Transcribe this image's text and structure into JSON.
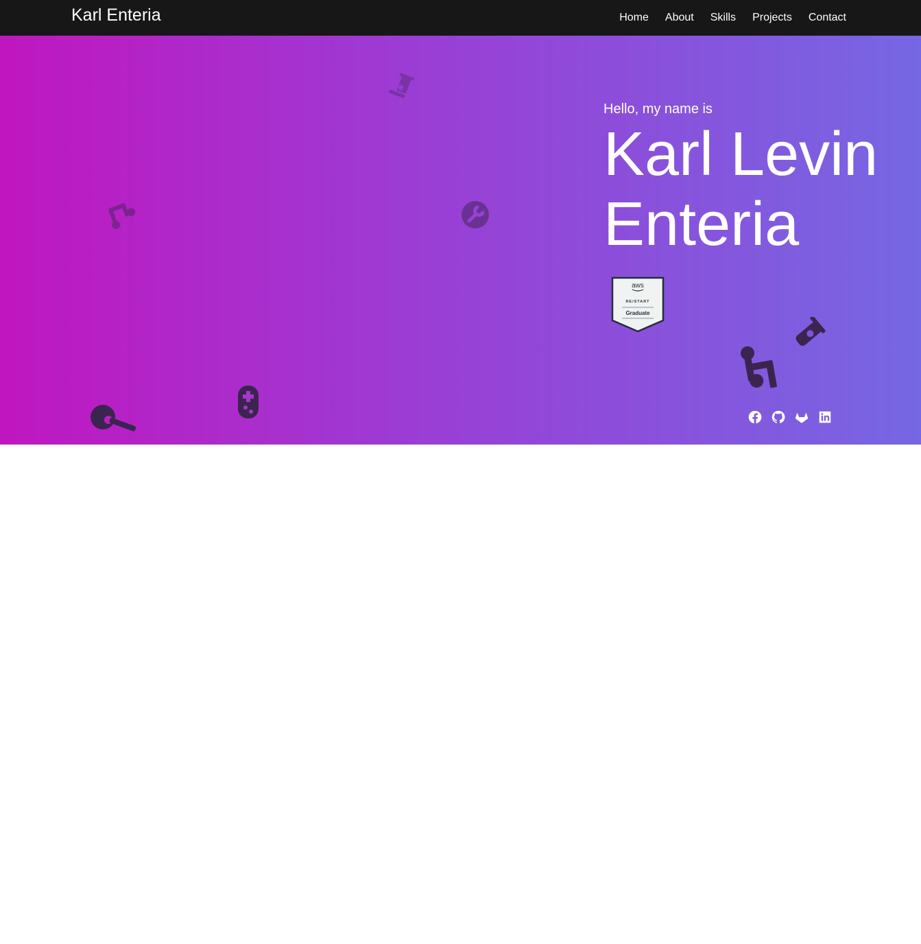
{
  "navbar": {
    "brand": "Karl Enteria",
    "links": [
      {
        "label": "Home"
      },
      {
        "label": "About"
      },
      {
        "label": "Skills"
      },
      {
        "label": "Projects"
      },
      {
        "label": "Contact"
      }
    ]
  },
  "hero": {
    "greeting": "Hello, my name is",
    "name_line1": "Karl Levin",
    "name_line2": "Enteria",
    "badge": {
      "brand": "aws",
      "program": "RE/START",
      "label": "Graduate"
    },
    "gradient": [
      "#c016c0",
      "#9b3dd4",
      "#7667e3"
    ],
    "decorative_icons": [
      "telescope-icon",
      "music-note-icon",
      "guitar-icon",
      "gamepad-icon",
      "wrench-icon",
      "microscope-icon"
    ],
    "socials": [
      {
        "name": "facebook-icon"
      },
      {
        "name": "github-icon"
      },
      {
        "name": "gitlab-icon"
      },
      {
        "name": "linkedin-icon"
      }
    ]
  },
  "colors": {
    "navbar_bg": "#171717",
    "text": "#ffffff",
    "icon_fill": "#3c2450"
  }
}
